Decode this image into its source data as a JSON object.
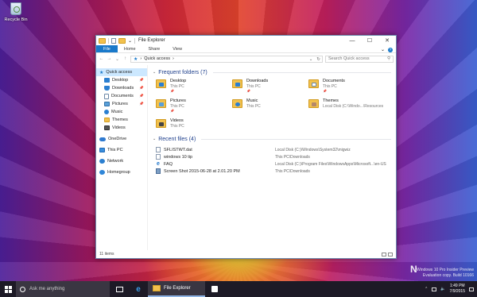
{
  "desktop": {
    "recycle_bin_label": "Recycle Bin",
    "watermark_line1": "Windows 10 Pro Insider Preview",
    "watermark_line2": "Evaluation copy. Build 10166"
  },
  "window": {
    "title": "File Explorer",
    "quick_access_dropdown": "⌄",
    "ribbon_tabs": [
      "File",
      "Home",
      "Share",
      "View"
    ],
    "address": {
      "crumb_arrow": "›",
      "location": "Quick access",
      "trail": "›"
    },
    "search_placeholder": "Search Quick access"
  },
  "nav_pane": {
    "items": [
      {
        "label": "Quick access",
        "icon": "star-icon",
        "selected": true
      },
      {
        "label": "Desktop",
        "icon": "desktop-icon",
        "pinned": true
      },
      {
        "label": "Downloads",
        "icon": "downloads-icon",
        "pinned": true
      },
      {
        "label": "Documents",
        "icon": "documents-icon",
        "pinned": true
      },
      {
        "label": "Pictures",
        "icon": "pictures-icon",
        "pinned": true
      },
      {
        "label": "Music",
        "icon": "music-icon"
      },
      {
        "label": "Themes",
        "icon": "folder-icon"
      },
      {
        "label": "Videos",
        "icon": "videos-icon"
      },
      {
        "label": "OneDrive",
        "icon": "onedrive-icon"
      },
      {
        "label": "This PC",
        "icon": "this-pc-icon"
      },
      {
        "label": "Network",
        "icon": "network-icon"
      },
      {
        "label": "Homegroup",
        "icon": "homegroup-icon"
      }
    ]
  },
  "frequent": {
    "header": "Frequent folders (7)",
    "folders": [
      {
        "name": "Desktop",
        "location": "This PC"
      },
      {
        "name": "Downloads",
        "location": "This PC"
      },
      {
        "name": "Documents",
        "location": "This PC"
      },
      {
        "name": "Pictures",
        "location": "This PC"
      },
      {
        "name": "Music",
        "location": "This PC"
      },
      {
        "name": "Themes",
        "location": "Local Disk (C:\\Windo...\\Resources"
      },
      {
        "name": "Videos",
        "location": "This PC"
      }
    ]
  },
  "recent": {
    "header": "Recent files (4)",
    "files": [
      {
        "name": "SFLISTWT.dat",
        "path": "Local Disk (C:)\\Windows\\System32\\migwiz"
      },
      {
        "name": "windows 10 tip",
        "path": "This PC\\Downloads"
      },
      {
        "name": "FAQ",
        "path": "Local Disk (C:)\\Program Files\\WindowsApps\\Microsoft...\\en-US"
      },
      {
        "name": "Screen Shot 2015-06-28 at 2.01.20 PM",
        "path": "This PC\\Downloads"
      }
    ]
  },
  "status": {
    "item_count": "11 items"
  },
  "taskbar": {
    "search_placeholder": "Ask me anything",
    "explorer_label": "File Explorer",
    "time": "1:49 PM",
    "date": "7/9/2015"
  }
}
